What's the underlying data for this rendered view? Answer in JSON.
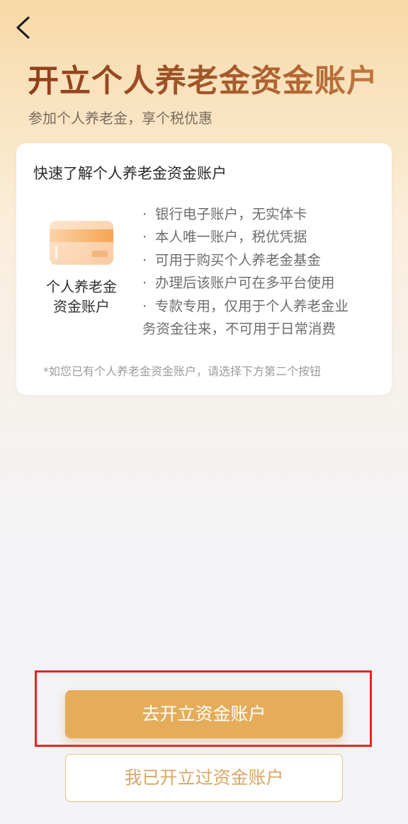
{
  "nav": {
    "back_icon": "chevron-left-icon"
  },
  "header": {
    "title": "开立个人养老金资金账户",
    "subtitle": "参加个人养老金，享个税优惠"
  },
  "card": {
    "title": "快速了解个人养老金资金账户",
    "image_icon": "bank-card-icon",
    "label_line1": "个人养老金",
    "label_line2": "资金账户",
    "bullet": "·",
    "features": [
      "银行电子账户，无实体卡",
      "本人唯一账户，税优凭据",
      "可用于购买个人养老金基金",
      "办理后该账户可在多平台使用",
      "专款专用，仅用于个人养老金业"
    ],
    "feature_continuation": "务资金往来，不可用于日常消费",
    "note": "*如您已有个人养老金资金账户，请选择下方第二个按钮"
  },
  "actions": {
    "primary_label": "去开立资金账户",
    "secondary_label": "我已开立过资金账户"
  },
  "colors": {
    "title_brown": "#9a4f23",
    "primary_button": "#e5ac5a",
    "secondary_text": "#dba663",
    "highlight_red": "#ec2222"
  }
}
